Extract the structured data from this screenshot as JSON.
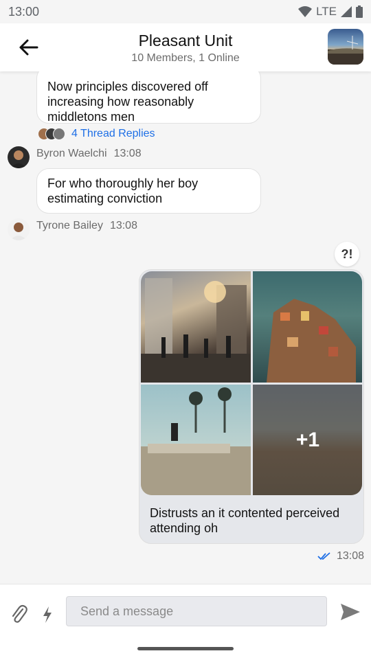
{
  "status_bar": {
    "time": "13:00",
    "network": "LTE",
    "icons": [
      "wifi-icon",
      "signal-icon",
      "battery-icon"
    ]
  },
  "header": {
    "title": "Pleasant Unit",
    "subtitle": "10 Members, 1 Online",
    "back_icon": "arrow-back-icon"
  },
  "messages": [
    {
      "text": "Now principles discovered off increasing how reasonably middletons men",
      "thread_replies": "4 Thread Replies"
    },
    {
      "author": "Byron Waelchi",
      "time": "13:08",
      "text": "For who thoroughly her boy estimating conviction"
    },
    {
      "author": "Tyrone Bailey",
      "time": "13:08"
    }
  ],
  "outgoing": {
    "reaction": "?!",
    "more_images": "+1",
    "text": "Distrusts an it contented perceived attending oh",
    "time": "13:08",
    "status_icon": "double-check-icon"
  },
  "composer": {
    "placeholder": "Send a message"
  },
  "colors": {
    "accent": "#1e6fe6",
    "bubble_out": "#e5e7eb",
    "bubble_in": "#ffffff",
    "background": "#f5f5f5"
  }
}
